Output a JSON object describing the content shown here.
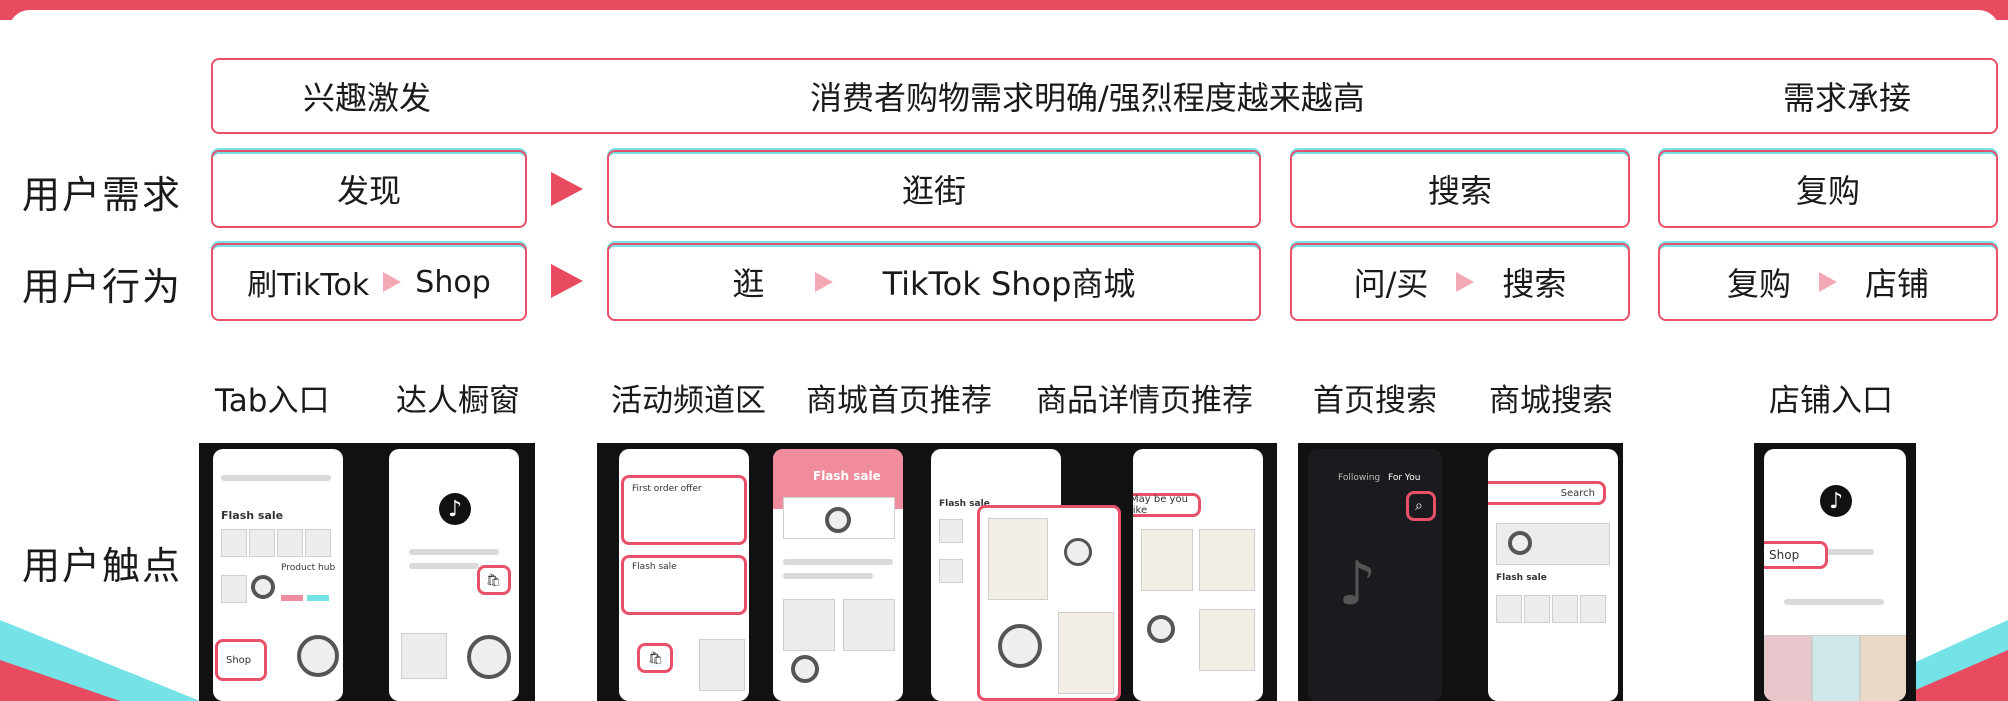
{
  "banner": {
    "left": "兴趣激发",
    "center": "消费者购物需求明确/强烈程度越来越高",
    "right": "需求承接"
  },
  "rows": {
    "need_label": "用户需求",
    "behavior_label": "用户行为",
    "touchpoint_label": "用户触点"
  },
  "needs": [
    "发现",
    "逛街",
    "搜索",
    "复购"
  ],
  "behaviors": [
    {
      "from": "刷TikTok",
      "to": "Shop"
    },
    {
      "from": "逛",
      "to": "TikTok Shop商城"
    },
    {
      "from": "问/买",
      "to": "搜索"
    },
    {
      "from": "复购",
      "to": "店铺"
    }
  ],
  "touchpoints": [
    "Tab入口",
    "达人橱窗",
    "活动频道区",
    "商城首页推荐",
    "商品详情页推荐",
    "首页搜索",
    "商城搜索",
    "店铺入口"
  ],
  "screens": {
    "shop_label": "Shop",
    "flash_sale": "Flash sale",
    "first_order": "First order offer",
    "may_like": "May be you like",
    "search": "Search",
    "tiktok_logo": "♪",
    "product_hub": "Product hub",
    "following": "Following",
    "for_you": "For You"
  },
  "colors": {
    "accent": "#e84a5f",
    "teal": "#74e2e6"
  }
}
